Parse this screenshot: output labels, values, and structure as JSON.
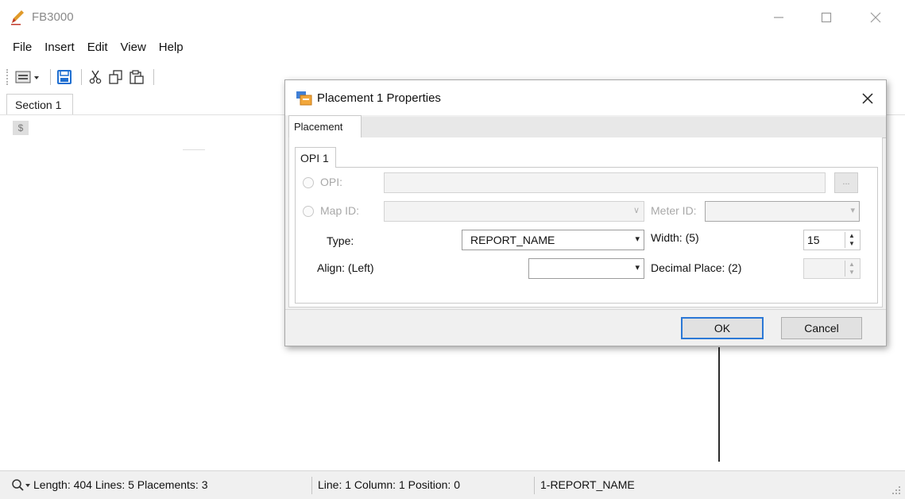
{
  "app": {
    "title": "FB3000"
  },
  "menu": [
    "File",
    "Insert",
    "Edit",
    "View",
    "Help"
  ],
  "document": {
    "tab": "Section 1",
    "marker": "$"
  },
  "dialog": {
    "title": "Placement 1 Properties",
    "outer_tab": "Placement",
    "inner_tab": "OPI 1",
    "opi_label": "OPI:",
    "opi_value": "",
    "opi_browse": "...",
    "map_id_label": "Map ID:",
    "meter_id_label": "Meter ID:",
    "type_label": "Type:",
    "type_value": "REPORT_NAME",
    "width_label": "Width: (5)",
    "width_value": "15",
    "align_label": "Align: (Left)",
    "align_value": "",
    "decimal_label": "Decimal Place: (2)",
    "decimal_value": "",
    "ok": "OK",
    "cancel": "Cancel"
  },
  "status": {
    "length": "Length: 404 Lines: 5 Placements: 3",
    "position": "Line: 1 Column: 1 Position: 0",
    "placement": "1-REPORT_NAME"
  },
  "colors": {
    "accent": "#2b78d6",
    "save_icon": "#1f6fd1",
    "app_icon": "#e09a2a"
  }
}
